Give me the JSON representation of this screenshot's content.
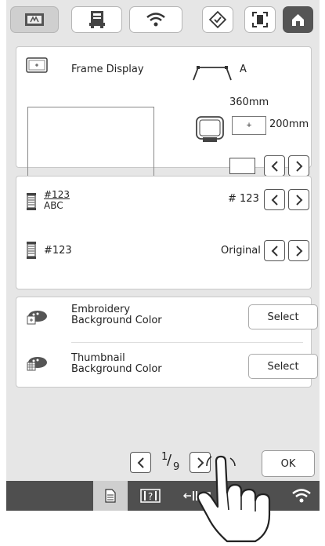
{
  "frame_section": {
    "title": "Frame Display",
    "frame_type": "A",
    "frame_width": "360mm",
    "frame_height": "200mm"
  },
  "number_section": {
    "icon_top": "#123",
    "icon_bottom": "ABC",
    "number_value": "# 123",
    "label2": "#123",
    "value2": "Original"
  },
  "color_section": {
    "embroidery_line1": "Embroidery",
    "embroidery_line2": "Background Color",
    "thumbnail_line1": "Thumbnail",
    "thumbnail_line2": "Background Color",
    "select_label": "Select"
  },
  "pager": {
    "current": "1",
    "total": "9"
  },
  "ok_label": "OK",
  "colors": {
    "background": "#e6e6e6",
    "bottom_bar": "#4f4f4f",
    "home_button": "#555555"
  }
}
